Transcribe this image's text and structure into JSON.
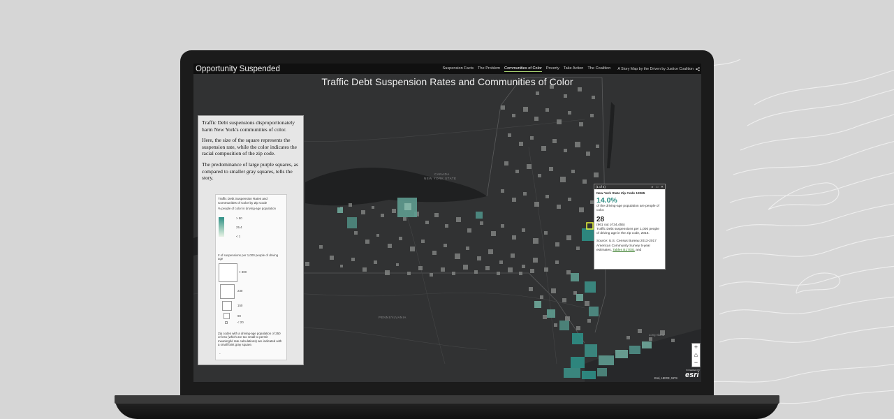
{
  "app": {
    "title": "Opportunity Suspended",
    "nav": [
      "Suspension Facts",
      "The Problem",
      "Communities of Color",
      "Poverty",
      "Take Action",
      "The Coalition"
    ],
    "active_nav_index": 2,
    "byline": "A Story Map by the Driven by Justice Coalition",
    "share_icon": "share-icon"
  },
  "map": {
    "title": "Traffic Debt Suspension Rates and Communities of Color",
    "labels": {
      "canada": "CANADA",
      "new_york": "NEW YORK STATE",
      "pennsylvania": "PENNSYLVANIA",
      "long_island": "Long Island"
    },
    "attribution": "Esri, HERE, NPS",
    "logo_text": "esri",
    "logo_powered": "POWERED BY"
  },
  "panel": {
    "paragraphs": [
      "Traffic Debt suspensions disproportionately harm New York's communities of color.",
      "Here, the size of the square represents the suspension rate, while the color indicates the racial composition of the zip code.",
      "The predominance of large purple squares, as compared to smaller gray squares, tells the story."
    ],
    "legend": {
      "title": "Traffic Debt Suspension Rates and Communities of Color by Zip Code",
      "color_label": "% people of color in driving-age population",
      "color_stops": [
        "> 50",
        "25.4",
        "< 1"
      ],
      "size_label": "# of suspensions per 1,000 people of driving age",
      "size_stops": [
        "> 300",
        "230",
        "150",
        "90",
        "< 20"
      ],
      "note": "Zip codes with a driving-age population of 250 or less (which are too small to permit meaningful rate calculations) are indicated with a small faint gray square.",
      "dash": "-"
    }
  },
  "popup": {
    "pager": "(1 of 4)",
    "title": "New York State Zip Code 12065",
    "percent": "14.0%",
    "percent_desc": "of the driving-age population are people of color.",
    "rate": "28",
    "rate_detail": "(961 out of 34,455)",
    "rate_desc": "Traffic Debt suspensions per 1,000 people of driving age in the zip code, 2016.",
    "source_pre": "Source: U.S. Census Bureau 2013-2017 American Community Survey 5-year estimates, ",
    "source_link": "Tables B17001",
    "source_post": " and"
  },
  "zoom": {
    "in": "+",
    "home": "⌂",
    "out": "−"
  },
  "colors": {
    "accent": "#a8d070",
    "teal": "#2a8a80",
    "map_bg": "#2f3031",
    "water": "#202122"
  }
}
